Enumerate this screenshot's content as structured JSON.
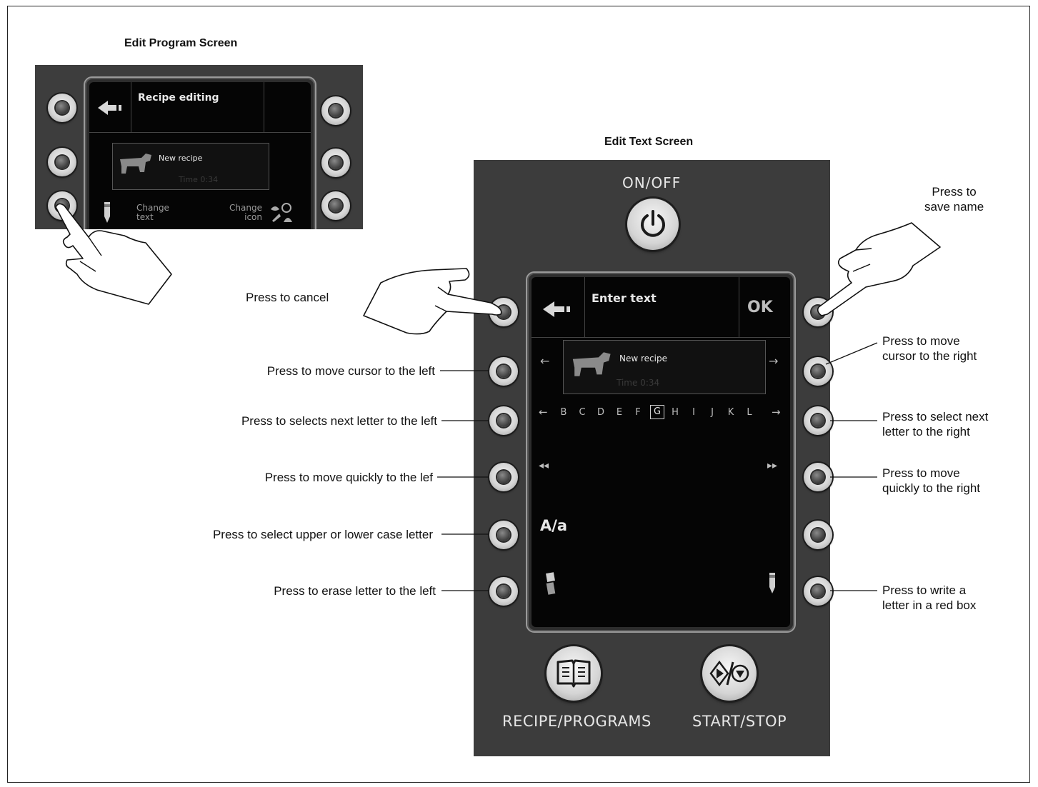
{
  "headings": {
    "edit_program": "Edit Program Screen",
    "edit_text": "Edit Text Screen"
  },
  "small_screen": {
    "title": "Recipe editing",
    "recipe_name": "New recipe",
    "recipe_time": "Time 0:34",
    "change_text": [
      "Change",
      "text"
    ],
    "change_icon": [
      "Change",
      "icon"
    ]
  },
  "edit_screen": {
    "title": "Enter text",
    "ok": "OK",
    "recipe_name": "New recipe",
    "recipe_time": "Time 0:34",
    "letters": [
      "B",
      "C",
      "D",
      "E",
      "F",
      "G",
      "H",
      "I",
      "J",
      "K",
      "L"
    ],
    "selected_letter": "G",
    "case_toggle": "A/a"
  },
  "panel": {
    "on_off": "ON/OFF",
    "recipe_programs": "RECIPE/PROGRAMS",
    "start_stop": "START/STOP"
  },
  "callouts": {
    "cancel": "Press to cancel",
    "cursor_left": "Press to move cursor to the left",
    "letter_left": "Press to selects next letter to the left",
    "quick_left": "Press to move quickly to the lef",
    "case": "Press to select upper or lower case letter",
    "erase": "Press to erase letter to the left",
    "save": [
      "Press to",
      "save name"
    ],
    "cursor_right": [
      "Press to move",
      "cursor to the right"
    ],
    "letter_right": [
      "Press to select next",
      "letter to the right"
    ],
    "quick_right": [
      "Press to move",
      "quickly to the right"
    ],
    "write": [
      "Press to write a",
      "letter in a red box"
    ]
  },
  "icons": [
    "power-icon",
    "back-arrow-icon",
    "book-icon",
    "start-stop-icon",
    "pencil-icon",
    "eraser-icon",
    "cow-icon",
    "pointing-hand-icon"
  ]
}
